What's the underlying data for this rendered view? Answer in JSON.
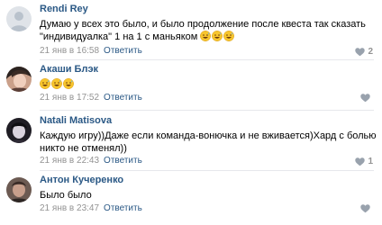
{
  "colors": {
    "name": "#2a5885",
    "meta": "#939393",
    "like": "#99a2ad",
    "divider": "#e7e8ec"
  },
  "comments": [
    {
      "author": "Rendi Rey",
      "text_lines": [
        "Думаю у всех это было, и было продолжение после квеста так сказать",
        "\"индивидуалка\" 1 на 1 с маньяком"
      ],
      "emoji": "grinning-sweat-emoji",
      "emoji_count": 3,
      "date": "21 янв в 16:58",
      "reply_label": "Ответить",
      "likes": "2"
    },
    {
      "author": "Акаши Блэк",
      "text_lines": [
        ""
      ],
      "emoji": "grinning-sweat-emoji",
      "emoji_count": 3,
      "date": "21 янв в 17:52",
      "reply_label": "Ответить",
      "likes": ""
    },
    {
      "author": "Natali Matisova",
      "text_lines": [
        "Каждую игру))Даже если команда-вонючка и не вживается)Хард с болью",
        "никто не отменял))"
      ],
      "date": "21 янв в 22:43",
      "reply_label": "Ответить",
      "likes": "1"
    },
    {
      "author": "Антон Кучеренко",
      "text_lines": [
        "Было было"
      ],
      "date": "21 янв в 23:47",
      "reply_label": "Ответить",
      "likes": ""
    }
  ]
}
